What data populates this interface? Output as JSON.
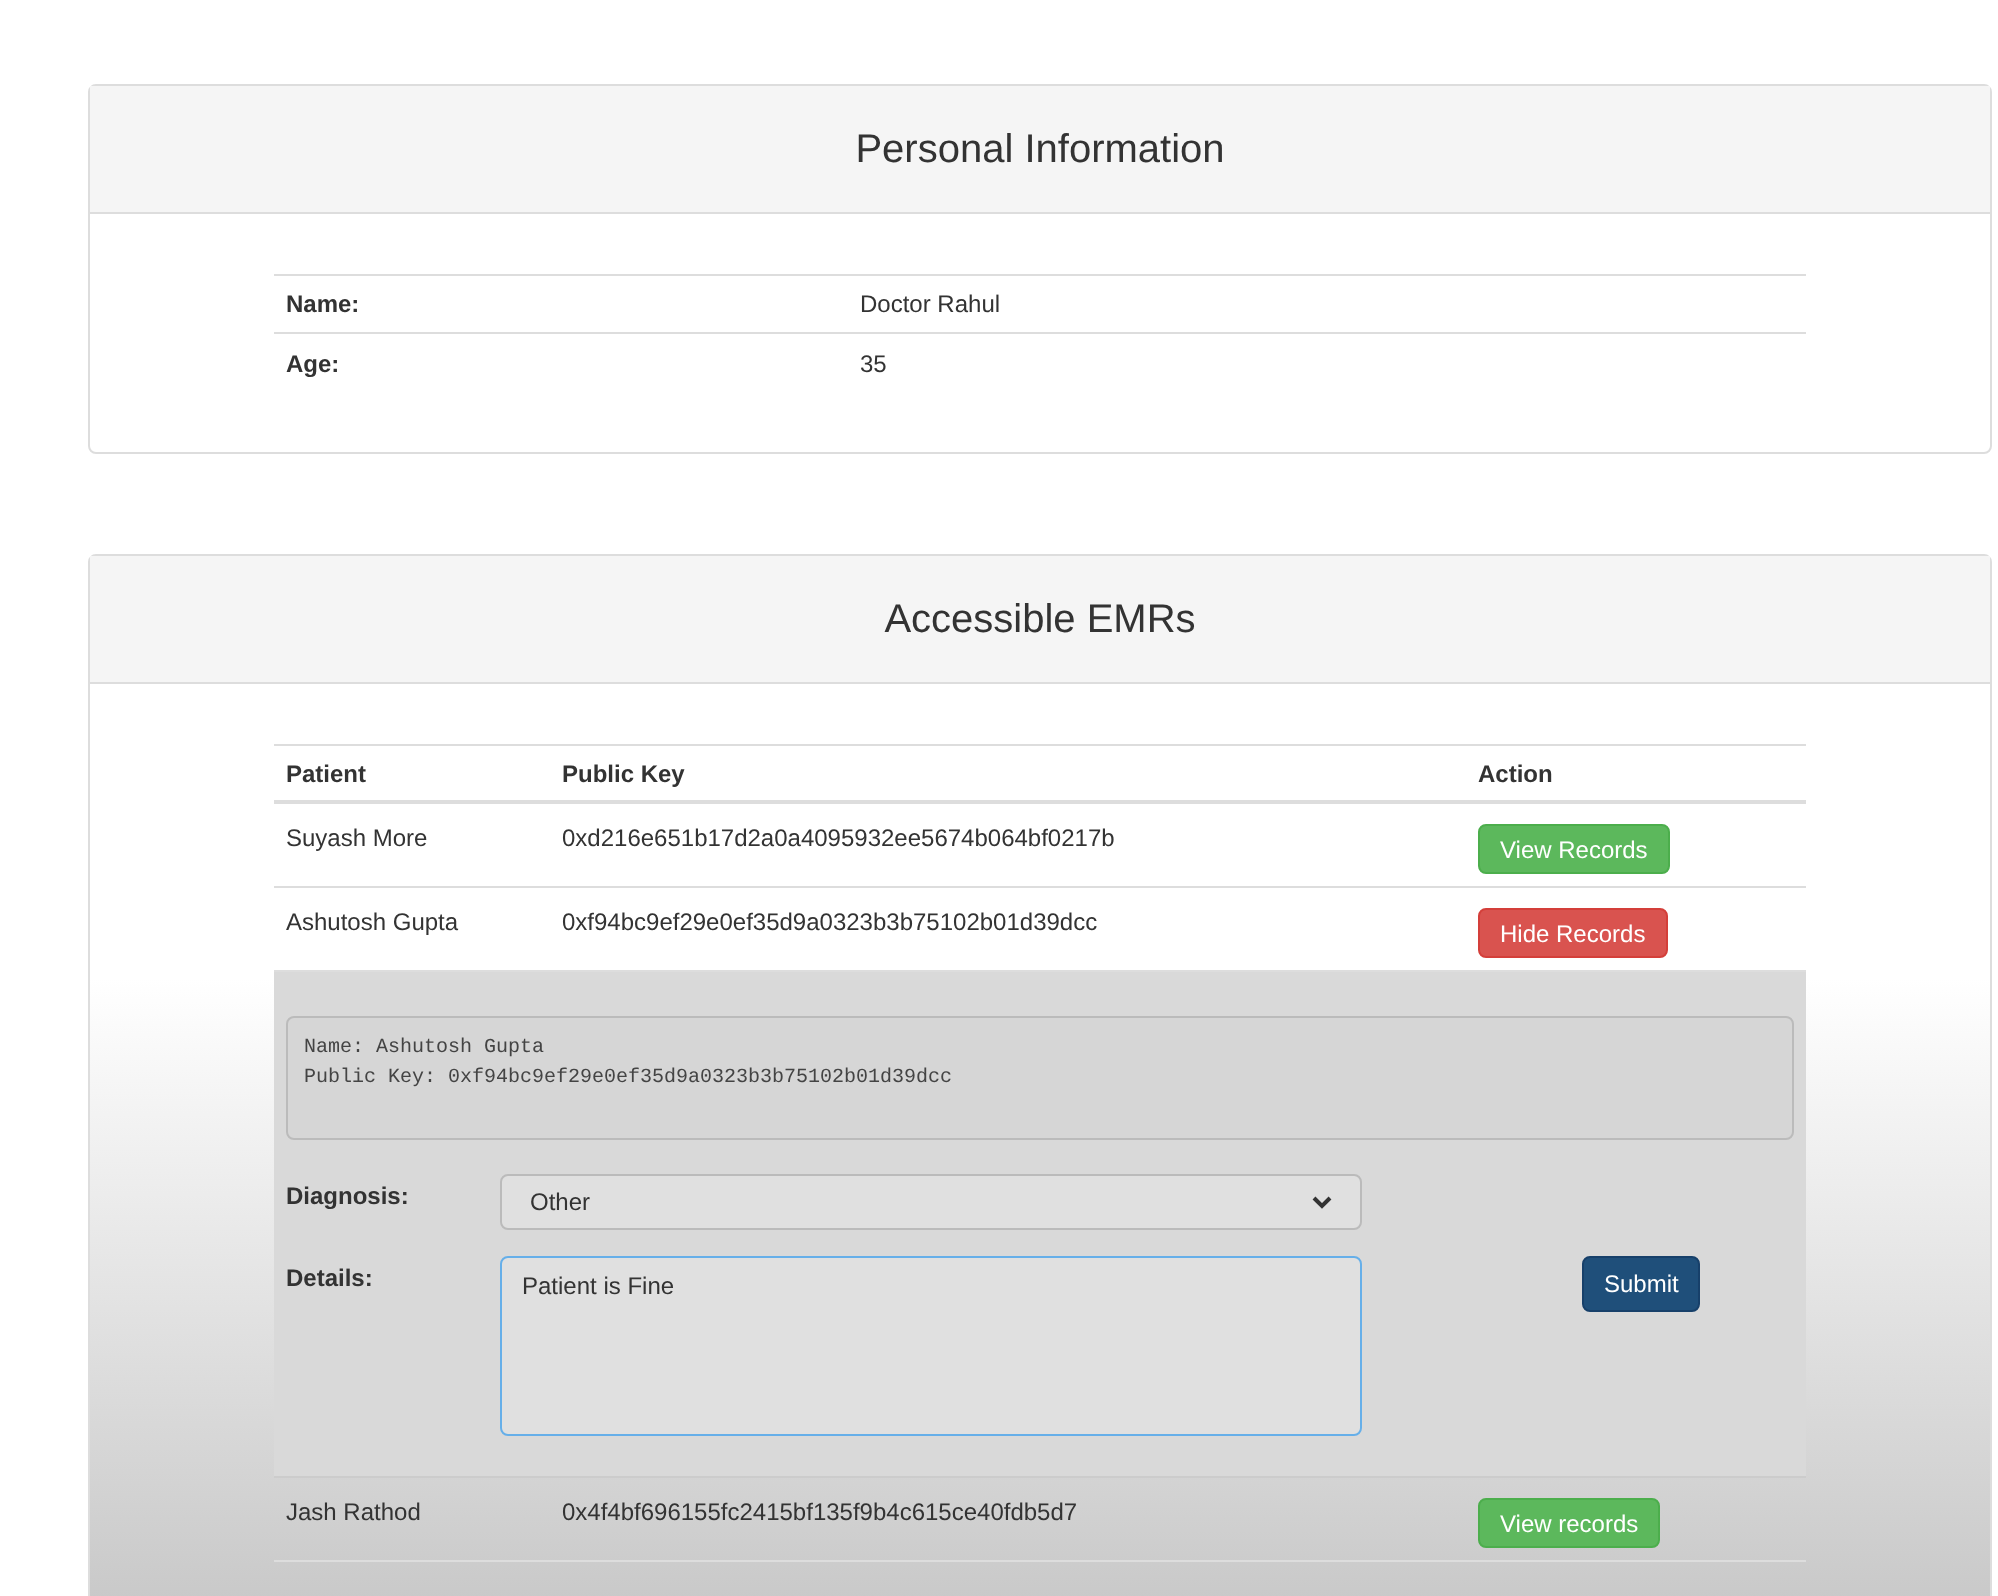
{
  "personal": {
    "title": "Personal Information",
    "rows": [
      {
        "label": "Name:",
        "value": "Doctor Rahul"
      },
      {
        "label": "Age:",
        "value": "35"
      }
    ]
  },
  "emrs": {
    "title": "Accessible EMRs",
    "columns": [
      "Patient",
      "Public Key",
      "Action"
    ],
    "rows": [
      {
        "patient": "Suyash More",
        "key": "0xd216e651b17d2a0a4095932ee5674b064bf0217b",
        "action": "View Records",
        "expanded": false
      },
      {
        "patient": "Ashutosh Gupta",
        "key": "0xf94bc9ef29e0ef35d9a0323b3b75102b01d39dcc",
        "action": "Hide Records",
        "expanded": true,
        "details": {
          "info_lines": [
            "Name: Ashutosh Gupta",
            "Public Key: 0xf94bc9ef29e0ef35d9a0323b3b75102b01d39dcc"
          ],
          "diagnosis_label": "Diagnosis:",
          "diagnosis": "Other",
          "details_label": "Details:",
          "details": "Patient is Fine",
          "submit": "Submit"
        }
      },
      {
        "patient": "Jash Rathod",
        "key": "0x4f4bf696155fc2415bf135f9b4c615ce40fdb5d7",
        "action": "View records",
        "expanded": false
      }
    ]
  }
}
